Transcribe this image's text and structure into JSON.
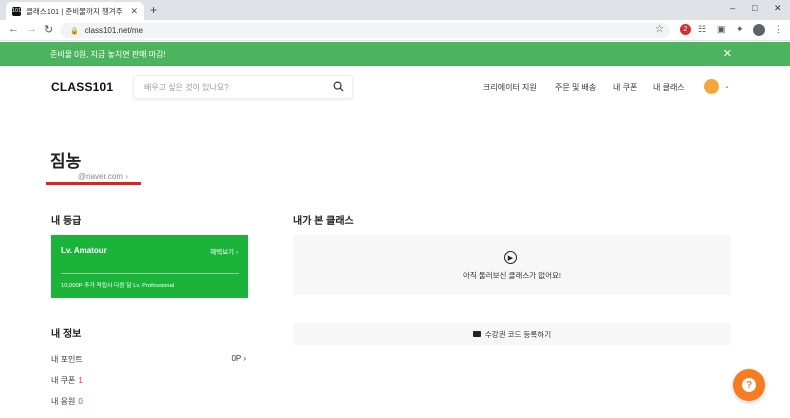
{
  "browser": {
    "tab_title": "클래스101 | 준비물까지 챙겨주",
    "favicon_text": "101",
    "tab_close": "✕",
    "new_tab": "+",
    "url": "class101.net/me",
    "ext_badge": "2"
  },
  "banner": {
    "text": "준비물 0원, 지금 놓치면 판매 마감!",
    "close": "✕",
    "color": "#4cb45f"
  },
  "header": {
    "logo": "CLASS101",
    "search_placeholder": "배우고 싶은 것이 있나요?",
    "menu": [
      "크리에이터 지원",
      "주문 및 배송",
      "내 쿠폰",
      "내 클래스"
    ]
  },
  "profile": {
    "name": "짐농",
    "email": "@naver.com ›"
  },
  "grade": {
    "section_title": "내 등급",
    "level": "Lv. Amatour",
    "benefit_link": "혜택보기 ›",
    "note": "10,000P 추가 적립시 다음 달 Lv. Professional",
    "card_color": "#1cb33a"
  },
  "my_info": {
    "section_title": "내 정보",
    "points_label": "내 포인트",
    "points_value": "0P ›",
    "coupons_label": "내 쿠폰",
    "coupons_count": "1",
    "cheers_label": "내 응원",
    "cheers_count": "0"
  },
  "viewed_classes": {
    "section_title": "내가 본 클래스",
    "empty_text": "아직 둘러보신 클래스가 없어요!"
  },
  "coupon_code": {
    "label": "수강권 코드 등록하기"
  },
  "help": {
    "label": "?"
  }
}
